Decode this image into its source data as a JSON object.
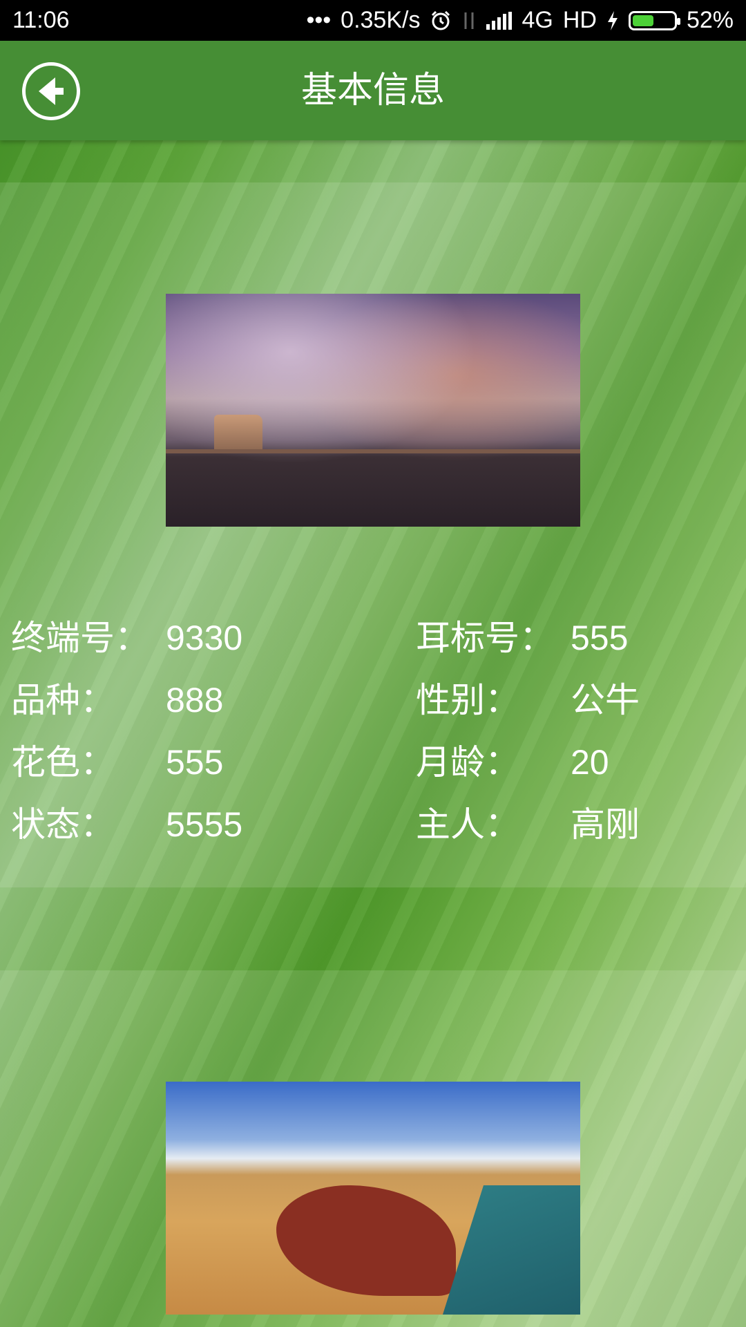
{
  "status_bar": {
    "time": "11:06",
    "dots": "•••",
    "speed": "0.35K/s",
    "network": "4G",
    "hd": "HD",
    "battery": "52%",
    "battery_level": 0.52
  },
  "toolbar": {
    "title": "基本信息",
    "back_icon": "arrow-left-circle-icon"
  },
  "info": {
    "rows": [
      {
        "left_label": "终端号：",
        "left_value": "9330",
        "right_label": "耳标号：",
        "right_value": "555"
      },
      {
        "left_label": "品种：",
        "left_value": "888",
        "right_label": "性别：",
        "right_value": "公牛"
      },
      {
        "left_label": "花色：",
        "left_value": "555",
        "right_label": "月龄：",
        "right_value": "20"
      },
      {
        "left_label": "状态：",
        "left_value": "5555",
        "right_label": "主人：",
        "right_value": "高刚"
      }
    ]
  }
}
